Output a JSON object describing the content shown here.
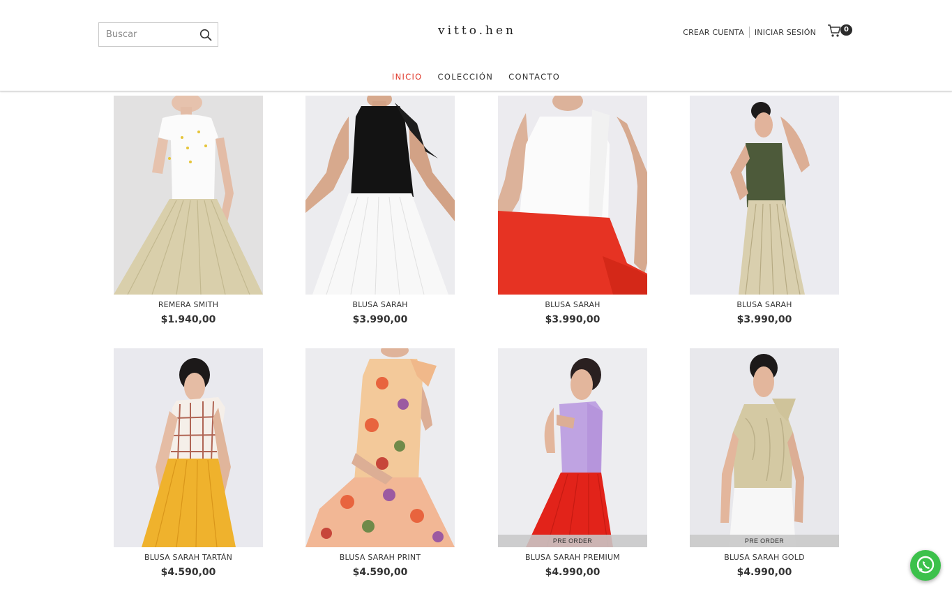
{
  "brand": {
    "logo_text": "vitto.hen"
  },
  "search": {
    "placeholder": "Buscar",
    "icon": "search-icon"
  },
  "account": {
    "create_label": "CREAR CUENTA",
    "login_label": "INICIAR SESIÓN"
  },
  "cart": {
    "icon": "cart-icon",
    "count": "0"
  },
  "nav": {
    "items": [
      "INICIO",
      "COLECCIÓN",
      "CONTACTO"
    ],
    "active": "INICIO",
    "active_color": "#e0392b"
  },
  "products": [
    {
      "name": "REMERA SMITH",
      "price": "$1.940,00"
    },
    {
      "name": "BLUSA SARAH",
      "price": "$3.990,00"
    },
    {
      "name": "BLUSA SARAH",
      "price": "$3.990,00"
    },
    {
      "name": "BLUSA SARAH",
      "price": "$3.990,00"
    },
    {
      "name": "BLUSA SARAH TARTÁN",
      "price": "$4.590,00"
    },
    {
      "name": "BLUSA SARAH PRINT",
      "price": "$4.590,00"
    },
    {
      "name": "BLUSA SARAH PREMIUM",
      "price": "$4.990,00",
      "badge": "PRE ORDER"
    },
    {
      "name": "BLUSA SARAH GOLD",
      "price": "$4.990,00",
      "badge": "PRE ORDER"
    }
  ],
  "whatsapp": {
    "icon": "whatsapp-icon",
    "color": "#3cc14b"
  }
}
